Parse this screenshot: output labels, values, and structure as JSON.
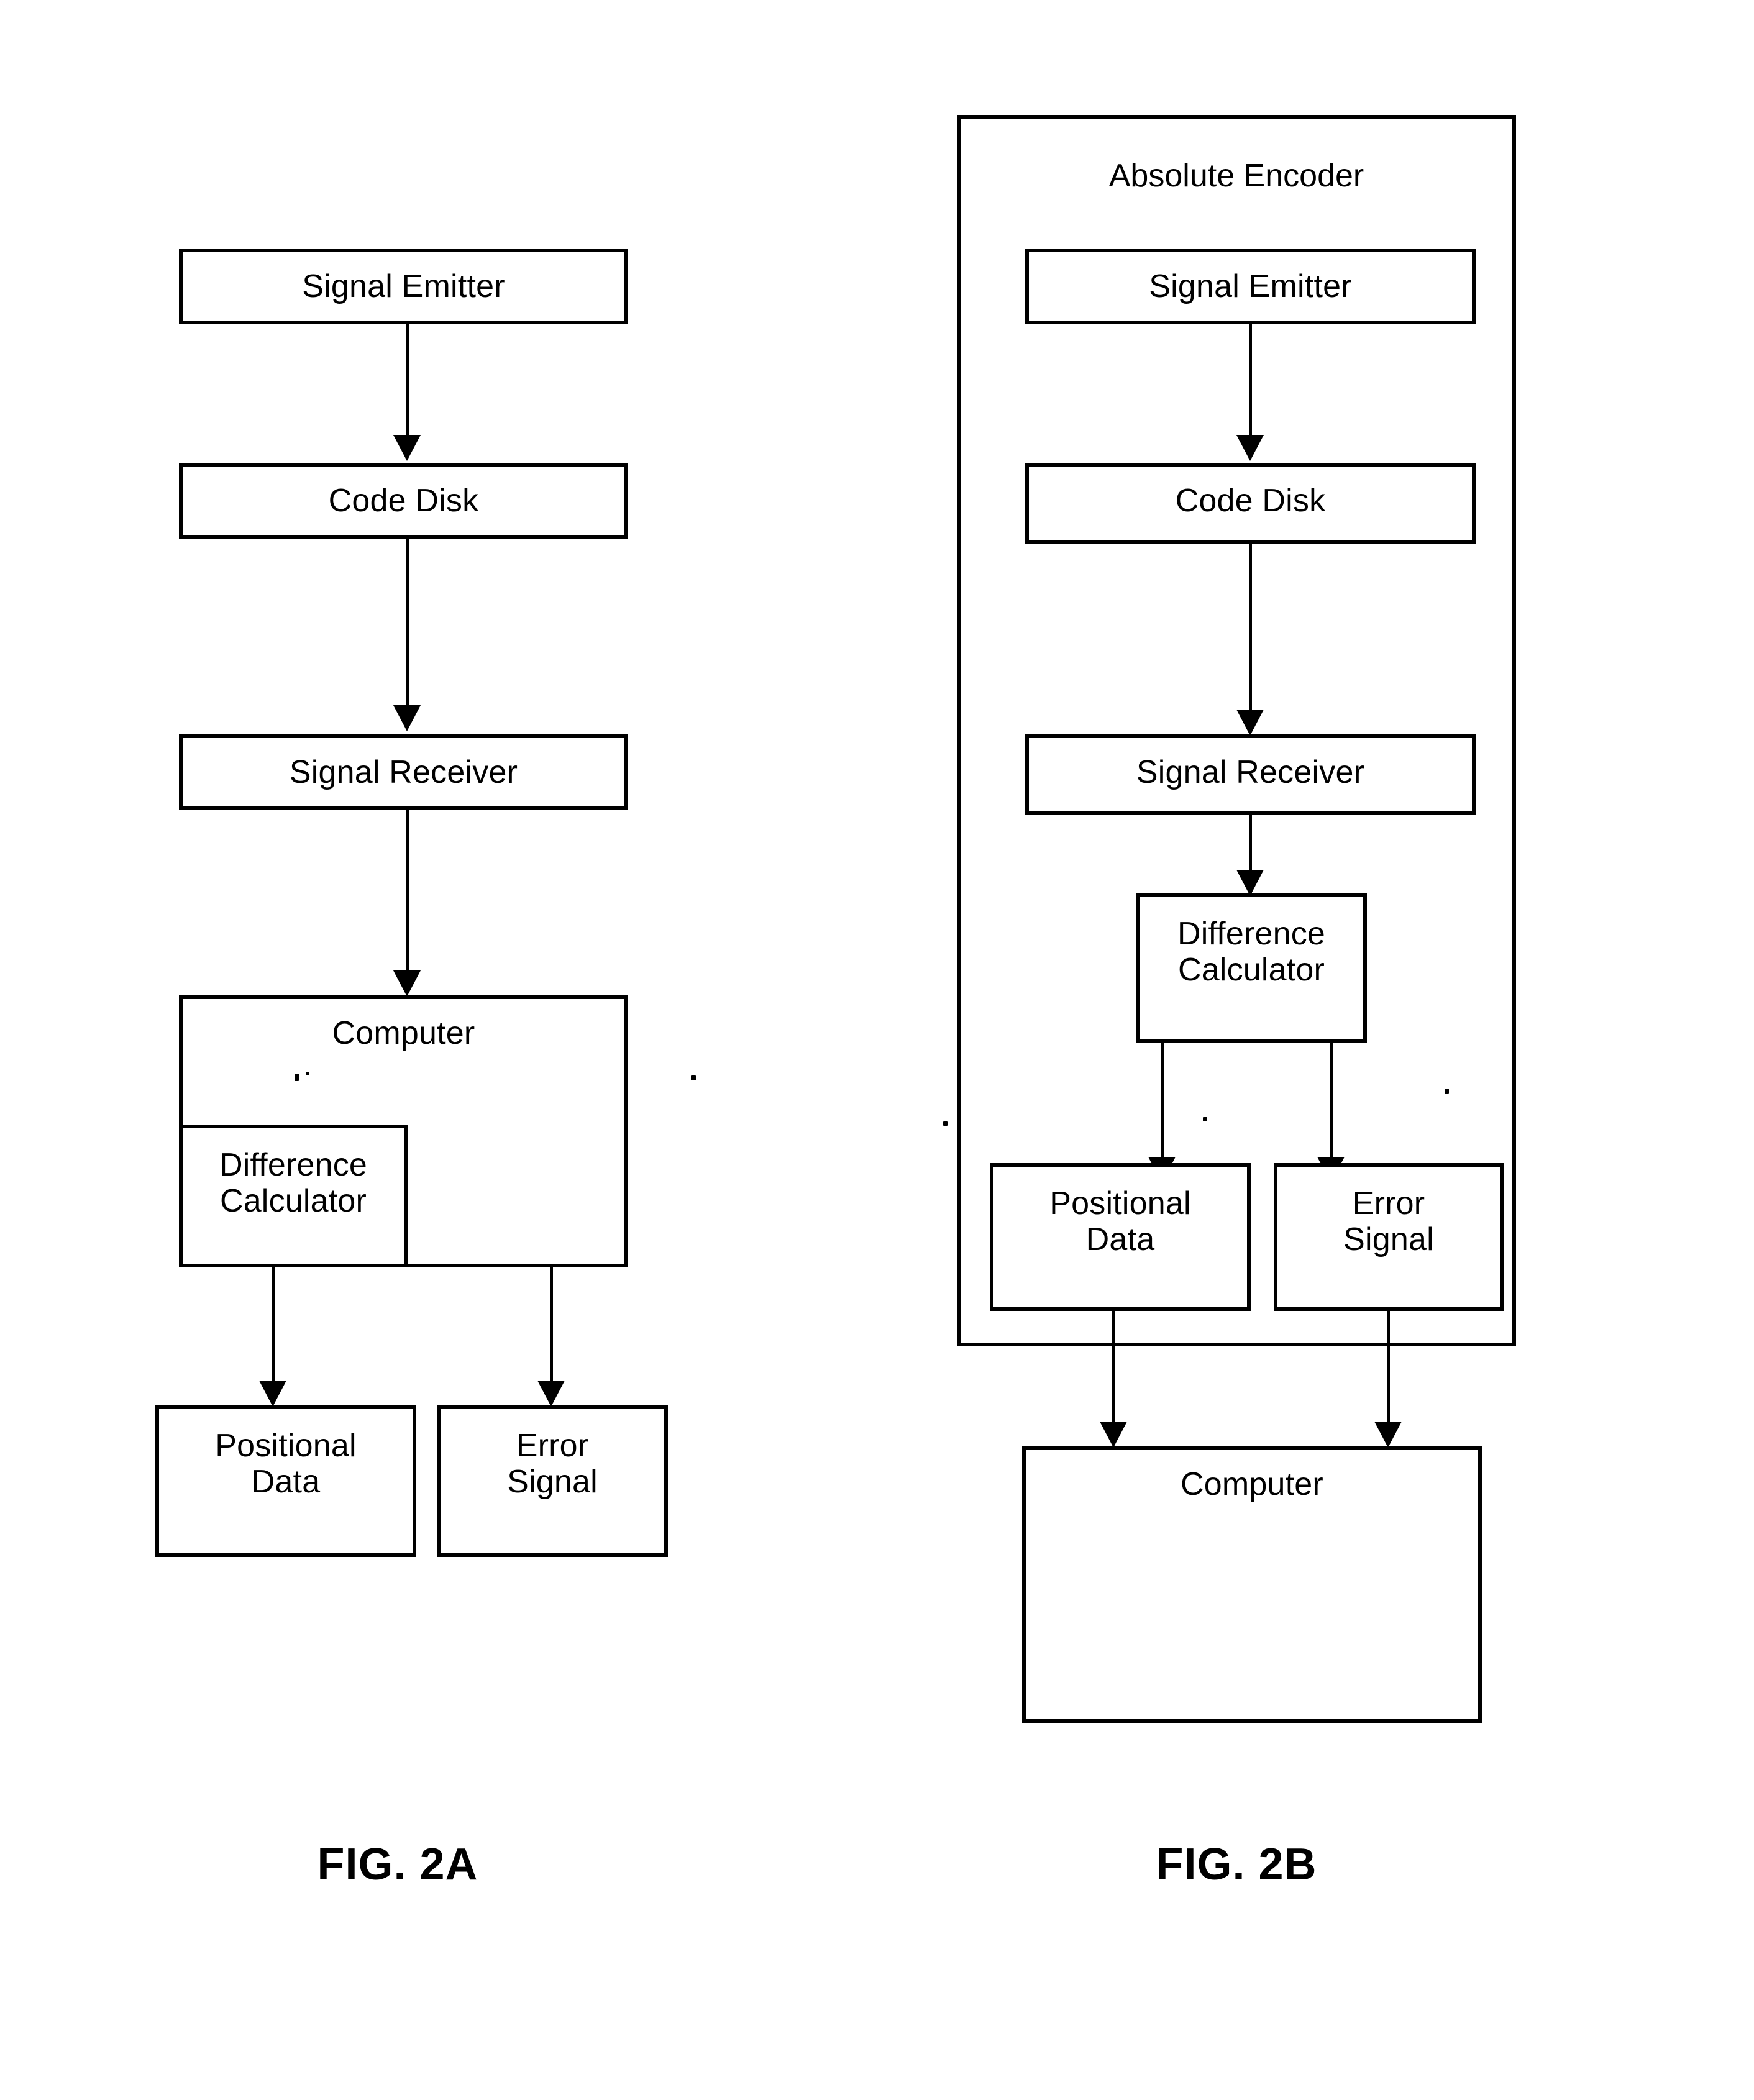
{
  "figures": [
    {
      "id": "fig-2a",
      "caption": "FIG. 2A",
      "nodes": {
        "signal_emitter": "Signal Emitter",
        "code_disk": "Code Disk",
        "signal_receiver": "Signal Receiver",
        "computer": "Computer",
        "difference_calculator": "Difference\nCalculator",
        "positional_data": "Positional\nData",
        "error_signal": "Error\nSignal"
      }
    },
    {
      "id": "fig-2b",
      "caption": "FIG. 2B",
      "container_title": "Absolute Encoder",
      "nodes": {
        "signal_emitter": "Signal Emitter",
        "code_disk": "Code Disk",
        "signal_receiver": "Signal Receiver",
        "difference_calculator": "Difference\nCalculator",
        "positional_data": "Positional\nData",
        "error_signal": "Error\nSignal",
        "computer": "Computer"
      }
    }
  ],
  "colors": {
    "ink": "#000000",
    "paper": "#ffffff"
  }
}
